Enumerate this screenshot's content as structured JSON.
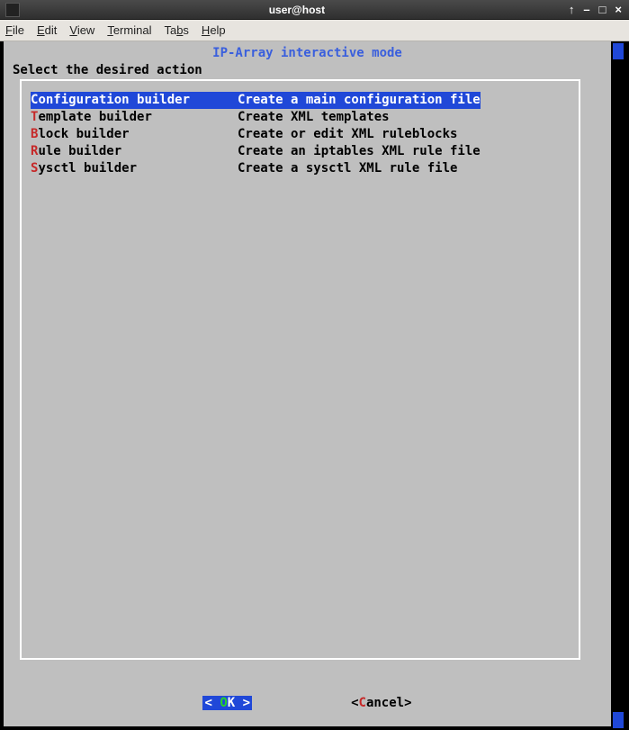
{
  "window": {
    "title": "user@host",
    "btn_up": "↑",
    "btn_min": "–",
    "btn_max": "□",
    "btn_close": "×"
  },
  "menubar": {
    "file": "File",
    "file_mn": "F",
    "edit": "Edit",
    "edit_mn": "E",
    "view": "View",
    "view_mn": "V",
    "terminal": "Terminal",
    "terminal_mn": "T",
    "tabs": "Tabs",
    "tabs_mn": "b",
    "help": "Help",
    "help_mn": "H"
  },
  "dialog": {
    "title": "IP-Array interactive mode",
    "prompt": "Select the desired action",
    "items": [
      {
        "hot": "C",
        "rest": "onfiguration builder",
        "desc": "Create a main configuration file",
        "selected": true
      },
      {
        "hot": "T",
        "rest": "emplate builder",
        "desc": "Create XML templates",
        "selected": false
      },
      {
        "hot": "B",
        "rest": "lock builder",
        "desc": "Create or edit XML ruleblocks",
        "selected": false
      },
      {
        "hot": "R",
        "rest": "ule builder",
        "desc": "Create an iptables XML rule file",
        "selected": false
      },
      {
        "hot": "S",
        "rest": "ysctl builder",
        "desc": "Create a sysctl XML rule file",
        "selected": false
      }
    ],
    "ok_left": "<  ",
    "ok_hot": "O",
    "ok_rest": "K",
    "ok_right": "  >",
    "cancel_left": "<",
    "cancel_hot": "C",
    "cancel_rest": "ancel>",
    "cancel_right": ""
  }
}
